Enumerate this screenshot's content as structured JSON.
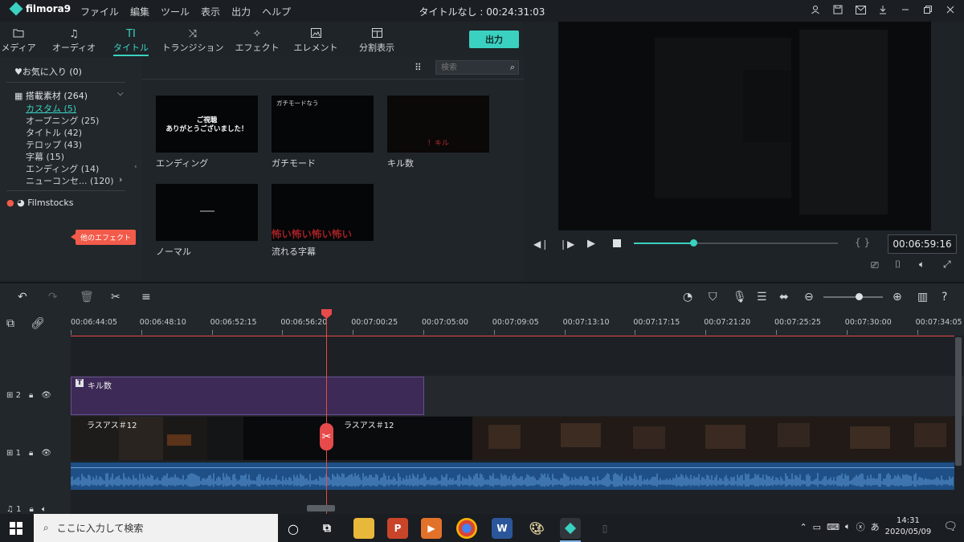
{
  "app": {
    "name": "filmora9",
    "title": "タイトルなし : 00:24:31:03"
  },
  "menu": [
    "ファイル",
    "編集",
    "ツール",
    "表示",
    "出力",
    "ヘルプ"
  ],
  "window_icons": [
    "user-icon",
    "save-icon",
    "mail-icon",
    "download-icon",
    "minimize-icon",
    "restore-icon",
    "close-icon"
  ],
  "tabs": [
    {
      "label": "メディア",
      "icon": "folder-icon"
    },
    {
      "label": "オーディオ",
      "icon": "music-icon"
    },
    {
      "label": "タイトル",
      "icon": "title-icon",
      "active": true
    },
    {
      "label": "トランジション",
      "icon": "transition-icon"
    },
    {
      "label": "エフェクト",
      "icon": "effect-icon"
    },
    {
      "label": "エレメント",
      "icon": "element-icon"
    },
    {
      "label": "分割表示",
      "icon": "split-icon"
    }
  ],
  "export_label": "出力",
  "library": {
    "favorites": "お気に入り (0)",
    "builtin": "搭載素材 (264)",
    "items": [
      "カスタム (5)",
      "オープニング (25)",
      "タイトル (42)",
      "テロップ (43)",
      "字幕 (15)",
      "エンディング (14)",
      "ニューコンセ... (120)"
    ],
    "filmstocks": "Filmstocks",
    "other_effects": "他のエフェクト"
  },
  "search": {
    "placeholder": "検索"
  },
  "thumbnails": [
    {
      "label": "エンディング",
      "text": "ご視聴\nありがとうございました！"
    },
    {
      "label": "ガチモード",
      "text": "ガチモードなう"
    },
    {
      "label": "キル数",
      "text": "！キル"
    },
    {
      "label": "ノーマル",
      "text": ""
    },
    {
      "label": "流れる字幕",
      "text": "怖い怖い怖い怖い"
    }
  ],
  "preview": {
    "timecode": "00:06:59:16",
    "progress": 0.29
  },
  "ruler_ticks": [
    "00:06:44:05",
    "00:06:48:10",
    "00:06:52:15",
    "00:06:56:20",
    "00:07:00:25",
    "00:07:05:00",
    "00:07:09:05",
    "00:07:13:10",
    "00:07:17:15",
    "00:07:21:20",
    "00:07:25:25",
    "00:07:30:00",
    "00:07:34:05"
  ],
  "tracks": {
    "title_clip": "キル数",
    "video_clip_a": "ラスアス＃12",
    "video_clip_b": "ラスアス＃12",
    "track2": "2",
    "track1": "1",
    "audio1": "1"
  },
  "zoom_level": 0.6,
  "taskbar": {
    "search_placeholder": "ここに入力して検索",
    "time": "14:31",
    "date": "2020/05/09"
  },
  "colors": {
    "accent": "#3ad1c1",
    "playhead": "#e64a4a",
    "title_clip": "#3d2a56",
    "audio": "#1e4f86"
  }
}
